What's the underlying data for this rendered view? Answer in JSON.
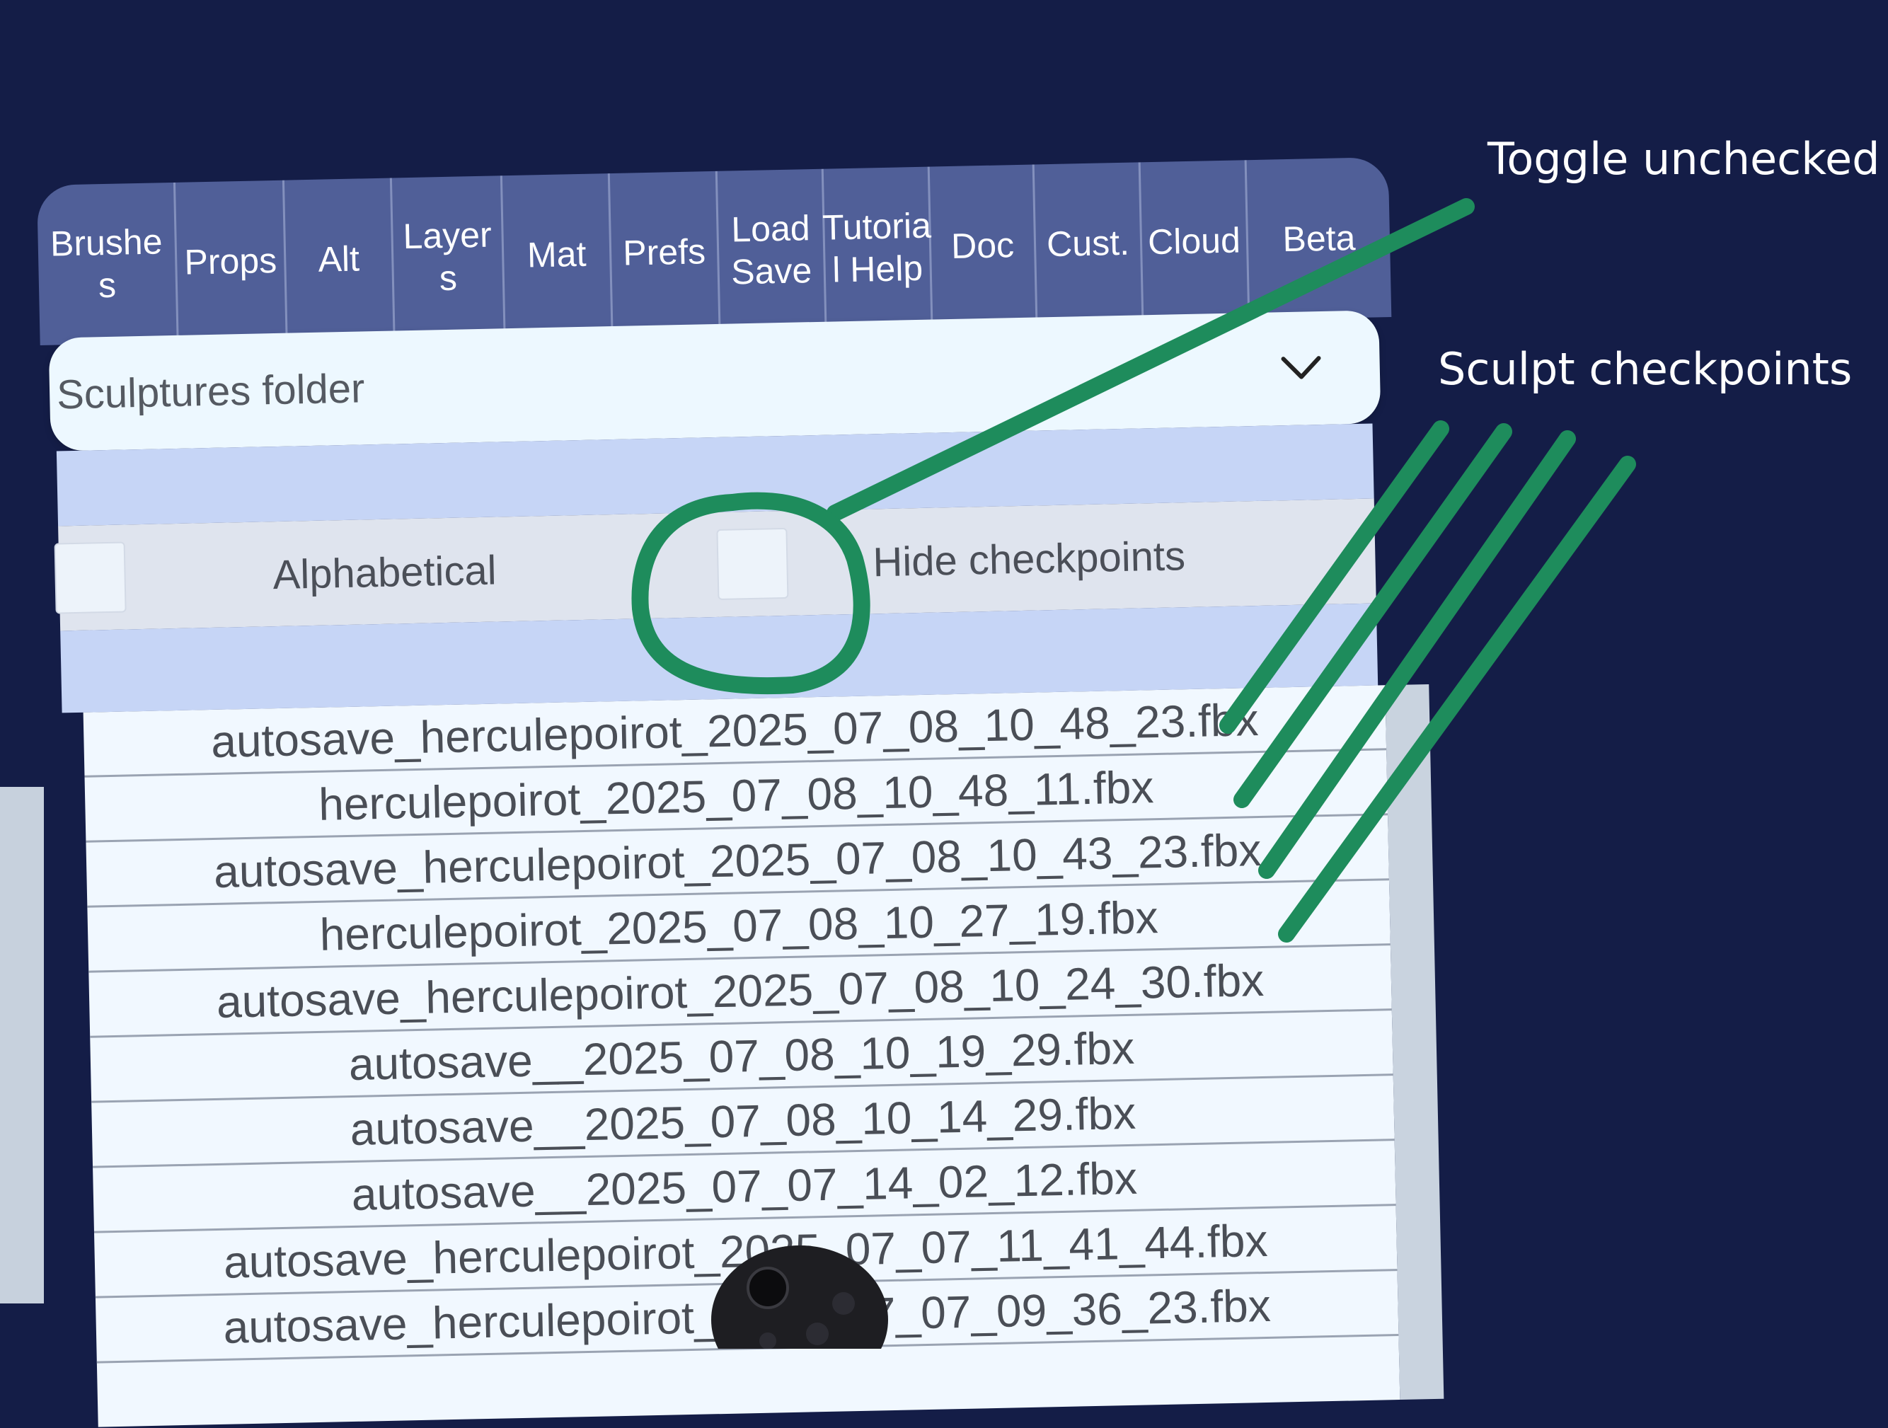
{
  "tabs": [
    {
      "label": "Brushe\ns"
    },
    {
      "label": "Props"
    },
    {
      "label": "Alt"
    },
    {
      "label": "Layer\ns"
    },
    {
      "label": "Mat"
    },
    {
      "label": "Prefs"
    },
    {
      "label": "Load\nSave"
    },
    {
      "label": "Tutoria\nl Help"
    },
    {
      "label": "Doc"
    },
    {
      "label": "Cust."
    },
    {
      "label": "Cloud"
    },
    {
      "label": "Beta"
    }
  ],
  "folder_dropdown": {
    "selected": "Sculptures folder",
    "icon": "chevron-down-icon"
  },
  "options": {
    "alphabetical_label": "Alphabetical",
    "alphabetical_checked": false,
    "hide_checkpoints_label": "Hide checkpoints",
    "hide_checkpoints_checked": false
  },
  "files": [
    "autosave_herculepoirot_2025_07_08_10_48_23.fbx",
    "herculepoirot_2025_07_08_10_48_11.fbx",
    "autosave_herculepoirot_2025_07_08_10_43_23.fbx",
    "herculepoirot_2025_07_08_10_27_19.fbx",
    "autosave_herculepoirot_2025_07_08_10_24_30.fbx",
    "autosave__2025_07_08_10_19_29.fbx",
    "autosave__2025_07_08_10_14_29.fbx",
    "autosave__2025_07_07_14_02_12.fbx",
    "autosave_herculepoirot_2025_07_07_11_41_44.fbx",
    "autosave_herculepoirot_2025_07_07_09_36_23.fbx"
  ],
  "annotations": {
    "toggle_unchecked": "Toggle unchecked",
    "sculpt_checkpoints": "Sculpt checkpoints",
    "color": "#1e8c5c"
  }
}
